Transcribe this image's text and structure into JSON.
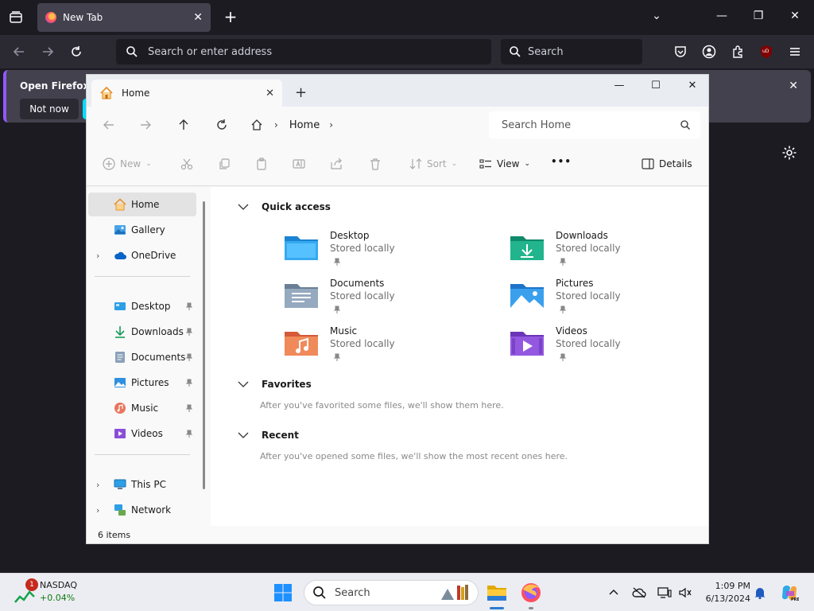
{
  "firefox": {
    "tab": {
      "title": "New Tab"
    },
    "url_placeholder": "Search or enter address",
    "search_placeholder": "Search",
    "notification": {
      "text": "Open Firefox ev",
      "not_now": "Not now"
    },
    "extension_badge": "uD"
  },
  "explorer": {
    "tab": {
      "label": "Home"
    },
    "breadcrumb": {
      "label": "Home"
    },
    "search_placeholder": "Search Home",
    "commands": {
      "new": "New",
      "sort": "Sort",
      "view": "View",
      "more": "•••",
      "details": "Details"
    },
    "sidebar": {
      "home": "Home",
      "gallery": "Gallery",
      "onedrive": "OneDrive",
      "desktop": "Desktop",
      "downloads": "Downloads",
      "documents": "Documents",
      "pictures": "Pictures",
      "music": "Music",
      "videos": "Videos",
      "thispc": "This PC",
      "network": "Network"
    },
    "status": "6 items",
    "quick_access": {
      "title": "Quick access",
      "items": [
        {
          "name": "Desktop",
          "sub": "Stored locally"
        },
        {
          "name": "Downloads",
          "sub": "Stored locally"
        },
        {
          "name": "Documents",
          "sub": "Stored locally"
        },
        {
          "name": "Pictures",
          "sub": "Stored locally"
        },
        {
          "name": "Music",
          "sub": "Stored locally"
        },
        {
          "name": "Videos",
          "sub": "Stored locally"
        }
      ]
    },
    "favorites": {
      "title": "Favorites",
      "empty": "After you've favorited some files, we'll show them here."
    },
    "recent": {
      "title": "Recent",
      "empty": "After you've opened some files, we'll show the most recent ones here."
    }
  },
  "taskbar": {
    "widget": {
      "badge": "1",
      "name": "NASDAQ",
      "change": "+0.04%"
    },
    "search_label": "Search",
    "time": "1:09 PM",
    "date": "6/13/2024"
  }
}
